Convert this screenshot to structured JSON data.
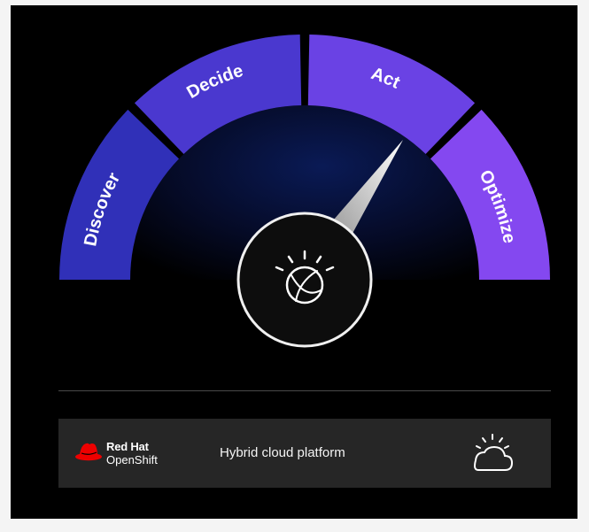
{
  "gauge": {
    "segments": [
      {
        "label": "Discover",
        "color": "#3030b8"
      },
      {
        "label": "Decide",
        "color": "#4a38cf"
      },
      {
        "label": "Act",
        "color": "#6a42e4"
      },
      {
        "label": "Optimize",
        "color": "#8448f0"
      }
    ],
    "active_segment": "Act",
    "center_icon": "ibm-watson-icon"
  },
  "platform_bar": {
    "brand_line1": "Red Hat",
    "brand_line2": "OpenShift",
    "label": "Hybrid cloud platform",
    "brand_icon": "red-hat-icon",
    "right_icon": "cloud-sun-icon"
  }
}
